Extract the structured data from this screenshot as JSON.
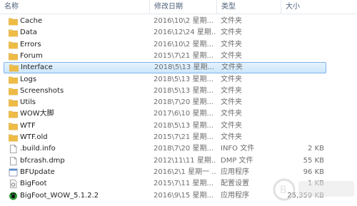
{
  "columns": {
    "name": "名称",
    "date": "修改日期",
    "type": "类型",
    "size": "大小"
  },
  "rows": [
    {
      "name": "Cache",
      "date": "2016\\10\\2 星期...",
      "type": "文件夹",
      "size": "",
      "icon": "folder-icon"
    },
    {
      "name": "Data",
      "date": "2016\\12\\24 星期...",
      "type": "文件夹",
      "size": "",
      "icon": "folder-icon"
    },
    {
      "name": "Errors",
      "date": "2016\\10\\2 星期...",
      "type": "文件夹",
      "size": "",
      "icon": "folder-icon"
    },
    {
      "name": "Forum",
      "date": "2015\\7\\21 星期...",
      "type": "文件夹",
      "size": "",
      "icon": "folder-icon"
    },
    {
      "name": "Interface",
      "date": "2018\\5\\13 星期...",
      "type": "文件夹",
      "size": "",
      "icon": "folder-icon",
      "selected": true
    },
    {
      "name": "Logs",
      "date": "2018\\5\\13 星期...",
      "type": "文件夹",
      "size": "",
      "icon": "folder-icon"
    },
    {
      "name": "Screenshots",
      "date": "2018\\5\\13 星期...",
      "type": "文件夹",
      "size": "",
      "icon": "folder-icon"
    },
    {
      "name": "Utils",
      "date": "2018\\7\\20 星期...",
      "type": "文件夹",
      "size": "",
      "icon": "folder-icon"
    },
    {
      "name": "WOW大脚",
      "date": "2017\\6\\10 星期...",
      "type": "文件夹",
      "size": "",
      "icon": "folder-icon"
    },
    {
      "name": "WTF",
      "date": "2018\\5\\13 星期...",
      "type": "文件夹",
      "size": "",
      "icon": "folder-icon"
    },
    {
      "name": "WTF.old",
      "date": "2015\\7\\21 星期...",
      "type": "文件夹",
      "size": "",
      "icon": "folder-icon"
    },
    {
      "name": ".build.info",
      "date": "2018\\7\\20 星期...",
      "type": "INFO 文件",
      "size": "2 KB",
      "icon": "file-icon"
    },
    {
      "name": "bfcrash.dmp",
      "date": "2012\\11\\11 星期...",
      "type": "DMP 文件",
      "size": "55 KB",
      "icon": "file-icon"
    },
    {
      "name": "BFUpdate",
      "date": "2016\\2\\1 星期一 ...",
      "type": "应用程序",
      "size": "96 KB",
      "icon": "app-icon"
    },
    {
      "name": "BigFoot",
      "date": "2015\\7\\11 星期...",
      "type": "配置设置",
      "size": "1 KB",
      "icon": "settings-file-icon"
    },
    {
      "name": "BigFoot_WOW_5.1.2.2",
      "date": "2016\\9\\15 星期...",
      "type": "应用程序",
      "size": "25,359 KB",
      "icon": "bigfoot-app-icon"
    }
  ],
  "colors": {
    "folder": "#e8b53c",
    "selection_fill": "#cde7fb",
    "selection_border": "#7eb4ea",
    "header_text": "#4c607a"
  }
}
